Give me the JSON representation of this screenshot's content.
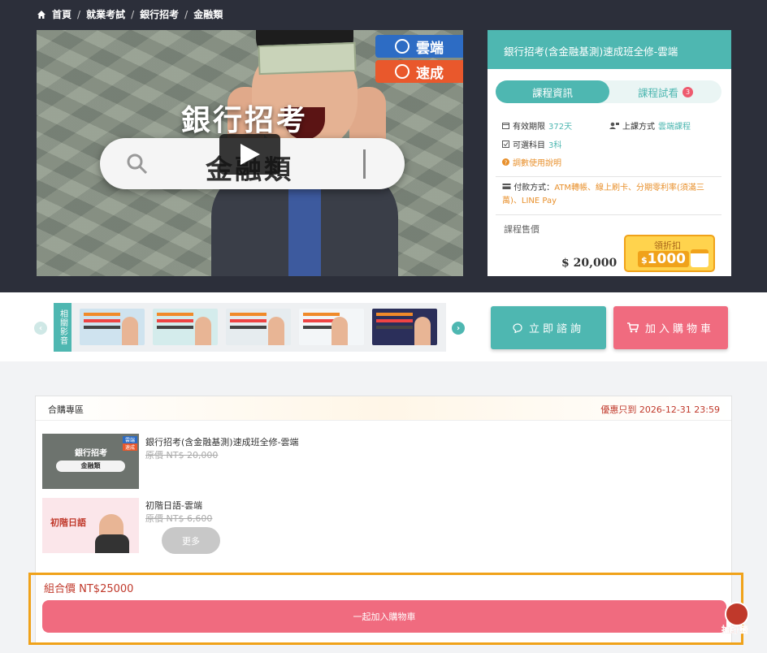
{
  "breadcrumb": {
    "home": "首頁",
    "level1": "就業考試",
    "level2": "銀行招考",
    "level3": "金融類"
  },
  "video": {
    "tag_cloud": "雲端",
    "tag_fast": "速成",
    "title": "銀行招考",
    "category": "金融類"
  },
  "course": {
    "title": "銀行招考(含金融基測)速成班全修-雲端",
    "tab_info": "課程資訊",
    "tab_trial": "課程試看",
    "trial_count": "3",
    "validity_label": "有效期限",
    "validity_value": "372天",
    "mode_label": "上課方式",
    "mode_value": "雲端課程",
    "subjects_label": "可選科目",
    "subjects_value": "3科",
    "voucher_link": "調數使用說明",
    "payment_label": "付款方式：",
    "payment_value": "ATM轉帳、線上刷卡、分期零利率(須滿三萬)、LINE Pay",
    "price_label": "課程售價",
    "price": "$ 20,000",
    "coupon_label": "領折扣",
    "coupon_currency": "$",
    "coupon_amount": "1000"
  },
  "related": {
    "label": "相關影音",
    "prev": "‹",
    "next": "›",
    "thumb_colors": [
      "#cfe3ef",
      "#d4ecec",
      "#e6ecef",
      "#f3f6f8",
      "#2b2f5a"
    ]
  },
  "actions": {
    "consult": "立即諮詢",
    "add_cart": "加入購物車"
  },
  "combo": {
    "title": "合購專區",
    "deadline": "優惠只到 2026-12-31 23:59",
    "items": [
      {
        "name": "銀行招考(含金融基測)速成班全修-雲端",
        "price": "原價 NT$ 20,000",
        "thumb_title": "銀行招考",
        "thumb_cat": "金融類",
        "thumb_tag1": "雲端",
        "thumb_tag2": "速成"
      },
      {
        "name": "初階日語-雲端",
        "price": "原價 NT$ 6,600",
        "thumb_title": "初階日語"
      }
    ],
    "more": "更多",
    "bundle_price": "組合價 NT$25000",
    "bundle_button": "一起加入購物車"
  },
  "mascot": {
    "label": "抽好籤"
  },
  "colors": {
    "teal": "#4eb7b1",
    "pink": "#f06b7f",
    "dark": "#2c2f3a",
    "highlight": "#f0a21a"
  }
}
